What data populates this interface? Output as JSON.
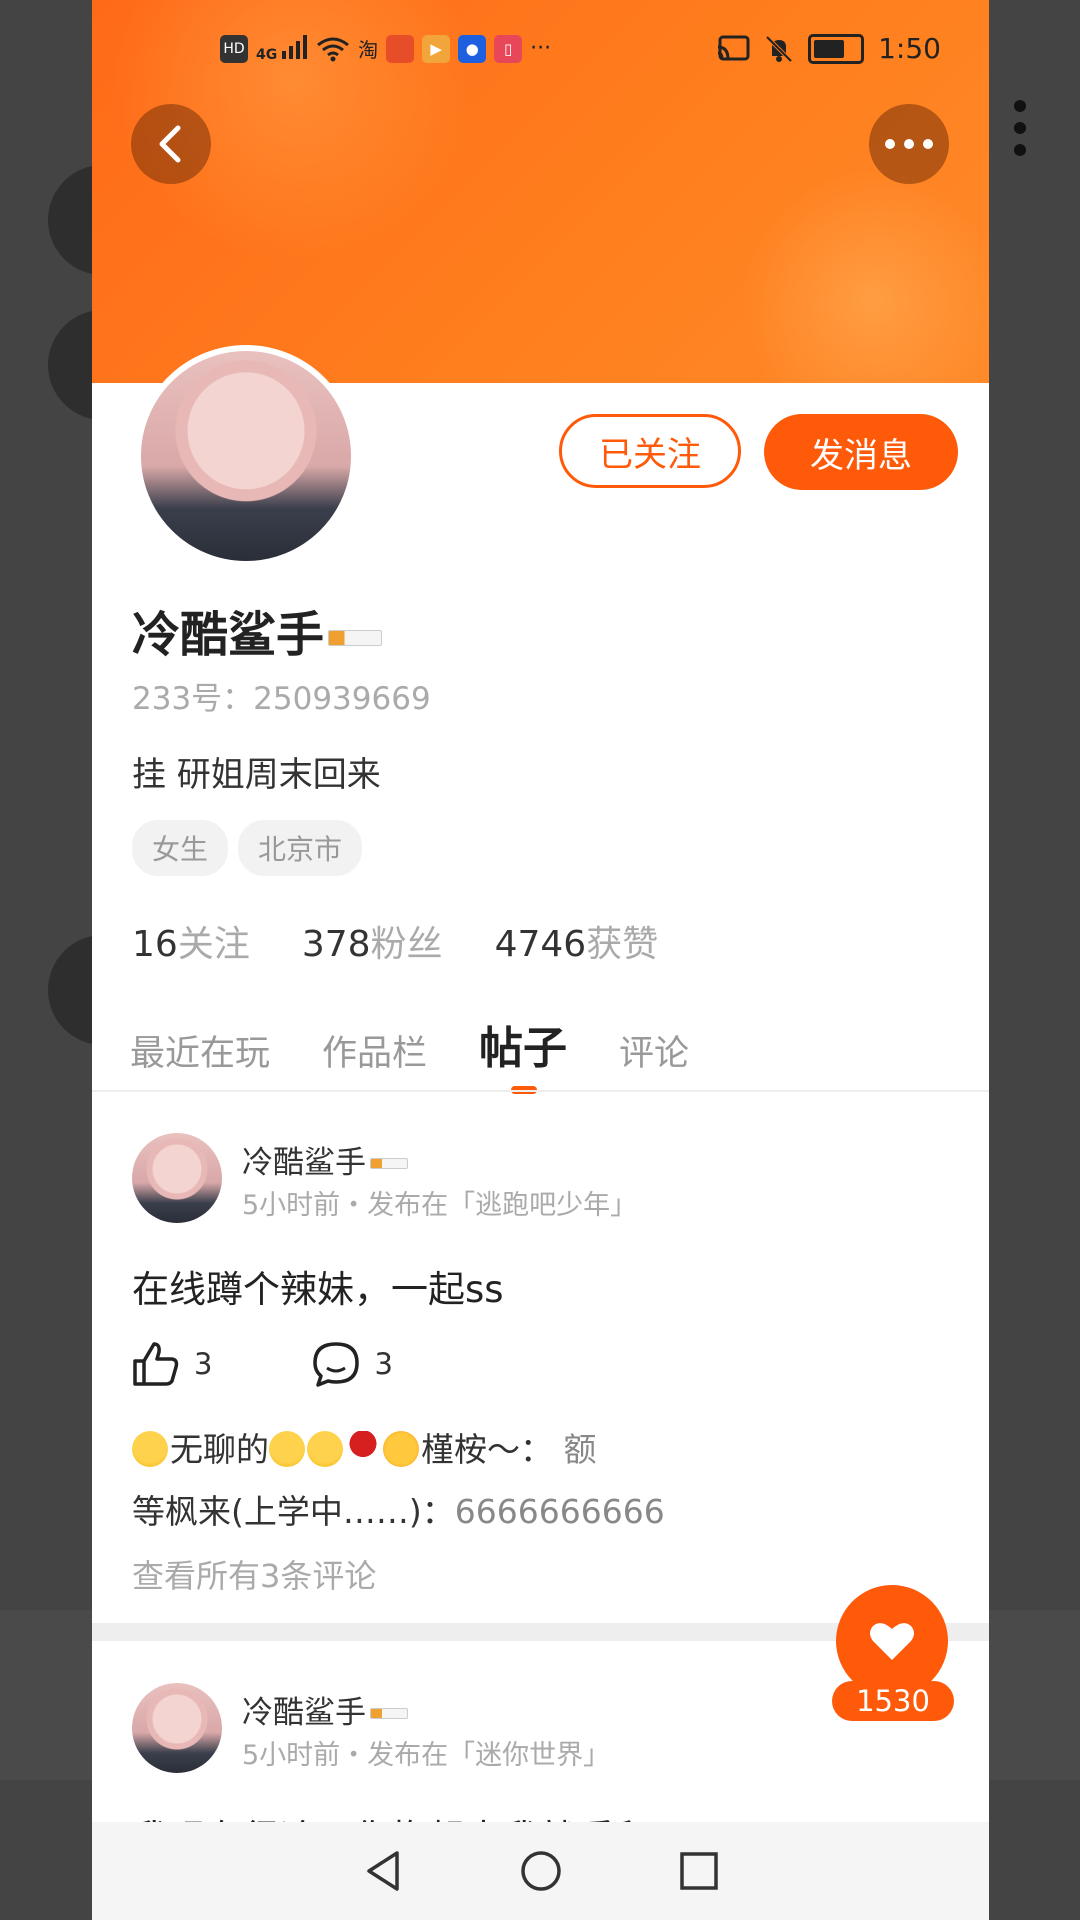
{
  "status_bar": {
    "left_icons": [
      "hd-icon",
      "signal-4g-icon",
      "wifi-icon",
      "taobao-icon",
      "taobao-app-icon",
      "play-app-icon",
      "bulb-app-icon",
      "book-app-icon"
    ],
    "hd": "HD",
    "net": "4G",
    "more": "···",
    "time": "1:50",
    "battery_level": 0.6
  },
  "header": {
    "back_icon": "chevron-left-icon",
    "more_icon": "more-horizontal-icon"
  },
  "profile": {
    "name": "冷酷鲨手",
    "id_line": "233号：250939669",
    "bio": "挂 研姐周末回来",
    "tags": [
      "女生",
      "北京市"
    ],
    "follow_button": "已关注",
    "message_button": "发消息",
    "stats": [
      {
        "num": "16",
        "label": "关注"
      },
      {
        "num": "378",
        "label": "粉丝"
      },
      {
        "num": "4746",
        "label": "获赞"
      }
    ]
  },
  "tabs": [
    {
      "label": "最近在玩",
      "active": false
    },
    {
      "label": "作品栏",
      "active": false
    },
    {
      "label": "帖子",
      "active": true
    },
    {
      "label": "评论",
      "active": false
    }
  ],
  "posts": [
    {
      "author": "冷酷鲨手",
      "meta": "5小时前・发布在「逃跑吧少年」",
      "text": "在线蹲个辣妹，一起ss",
      "likes": "3",
      "comments": "3",
      "comment_lines": [
        {
          "author": "无聊的",
          "author_suffix": "槿桉～：",
          "body": "额"
        },
        {
          "author": "等枫来(上学中……)：",
          "body": "6666666666"
        }
      ],
      "view_all": "查看所有3条评论"
    },
    {
      "author": "冷酷鲨手",
      "meta": "5小时前・发布在「迷你世界」",
      "text": "我现在很冷，你抱起来我就暖和了"
    }
  ],
  "like_fab": {
    "count": "1530",
    "icon": "heart-icon"
  },
  "nav": {
    "back": "nav-back-icon",
    "home": "nav-home-icon",
    "recent": "nav-recent-icon"
  },
  "colors": {
    "accent": "#ff5a0a",
    "banner": "#ff7a1a"
  }
}
